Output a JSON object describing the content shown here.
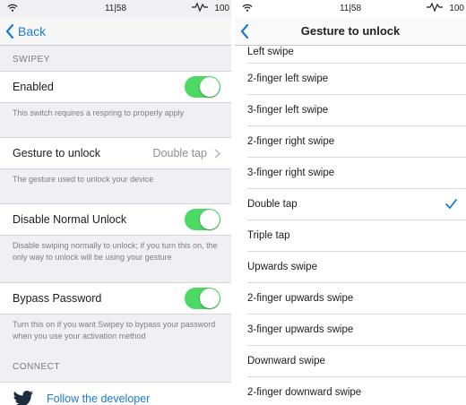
{
  "left": {
    "status": {
      "time": "11|58",
      "battery": "100"
    },
    "nav": {
      "back_label": "Back"
    },
    "section_swipey": "SWIPEY",
    "enabled": {
      "label": "Enabled",
      "on": true,
      "note": "This switch requires a respring to properly apply"
    },
    "gesture": {
      "label": "Gesture to unlock",
      "value": "Double tap",
      "note": "The gesture used to unlock your device"
    },
    "disable_unlock": {
      "label": "Disable Normal Unlock",
      "on": true,
      "note": "Disable swiping normally to unlock; if you turn this on, the only way to unlock will be using your gesture"
    },
    "bypass": {
      "label": "Bypass Password",
      "on": true,
      "note": "Turn this on if you want Swipey to bypass your password when you use your activation method"
    },
    "section_connect": "CONNECT",
    "follow_label": "Follow the developer"
  },
  "right": {
    "status": {
      "time": "11|58",
      "battery": "100"
    },
    "nav": {
      "title": "Gesture to unlock"
    },
    "items": [
      {
        "label": "Left swipe"
      },
      {
        "label": "2-finger left swipe"
      },
      {
        "label": "3-finger left swipe"
      },
      {
        "label": "2-finger right swipe"
      },
      {
        "label": "3-finger right swipe"
      },
      {
        "label": "Double tap",
        "selected": true
      },
      {
        "label": "Triple tap"
      },
      {
        "label": "Upwards swipe"
      },
      {
        "label": "2-finger upwards swipe"
      },
      {
        "label": "3-finger upwards swipe"
      },
      {
        "label": "Downward swipe"
      },
      {
        "label": "2-finger downward swipe"
      }
    ]
  },
  "colors": {
    "accent": "#1a7ad6",
    "toggle_on": "#4cd964",
    "background": "#efeff4",
    "secondary_text": "#8e8e93"
  },
  "icons": {
    "wifi": "wifi-icon",
    "activity": "activity-icon",
    "back": "chevron-left-icon",
    "disclosure": "chevron-right-icon",
    "twitter": "twitter-bird-icon",
    "check": "checkmark-icon"
  }
}
